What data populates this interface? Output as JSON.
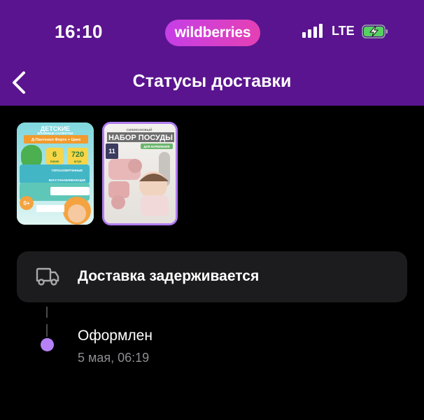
{
  "status_bar": {
    "time": "16:10",
    "brand": "wildberries",
    "network": "LTE",
    "icons": [
      "signal-icon",
      "battery-charging-icon"
    ]
  },
  "header": {
    "title": "Статусы доставки",
    "back_icon": "chevron-left-icon"
  },
  "colors": {
    "header_bg": "#5a148f",
    "brand_gradient_start": "#c53fe6",
    "brand_gradient_end": "#e540b4",
    "accent": "#b681f7",
    "card_bg": "#1c1c1e"
  },
  "products": [
    {
      "name": "baby-wipes",
      "lines": [
        "ДЕТСКИЕ",
        "ВЛАЖНЫЕ САЛФЕТКИ",
        "Д-Пантенол Форте",
        "+ Цинк"
      ],
      "packs": "6",
      "packs_unit": "пачек",
      "count": "720",
      "count_unit": "штук",
      "tags": [
        "ГИПОАЛЛЕРГЕННЫЕ",
        "ВОССТАНАВЛИВАЮЩИЕ"
      ],
      "age": "0+",
      "selected": false
    },
    {
      "name": "silicone-dish-set",
      "lines": [
        "СИЛИКОНОВЫЙ",
        "НАБОР ПОСУДЫ",
        "ДЛЯ КОРМЛЕНИЯ"
      ],
      "count": "11",
      "selected": true
    }
  ],
  "delivery_card": {
    "icon": "truck-icon",
    "label": "Доставка задерживается"
  },
  "timeline": [
    {
      "title": "Оформлен",
      "date": "5 мая, 06:19"
    }
  ]
}
